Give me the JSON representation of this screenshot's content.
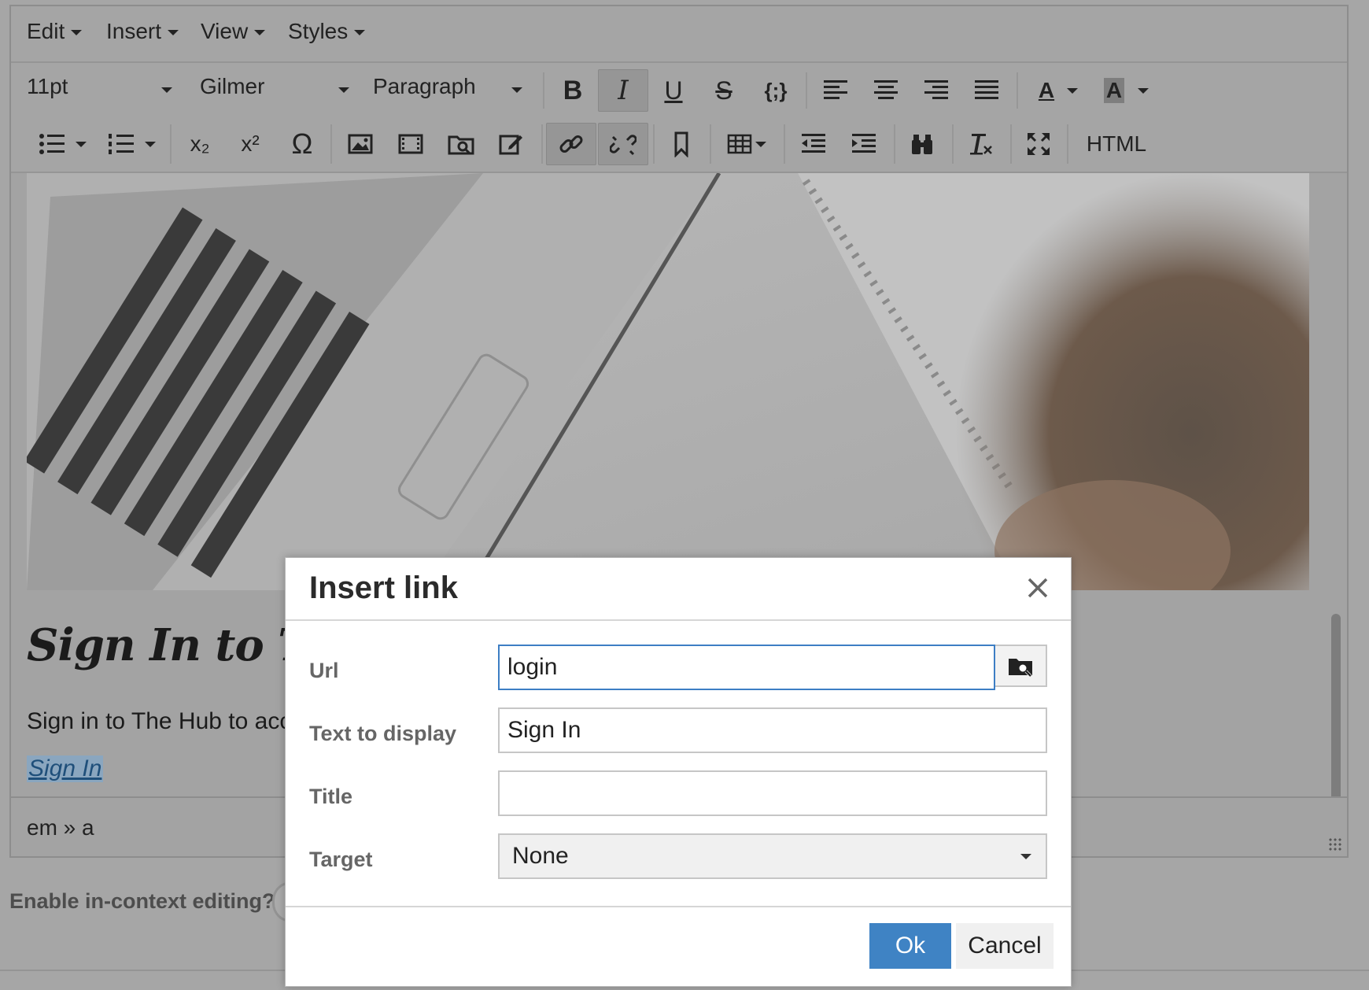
{
  "menubar": {
    "items": [
      {
        "label": "Edit"
      },
      {
        "label": "Insert"
      },
      {
        "label": "View"
      },
      {
        "label": "Styles"
      }
    ]
  },
  "toolbar": {
    "font_size": "11pt",
    "font_family": "Gilmer",
    "block_format": "Paragraph",
    "bold_label": "B",
    "italic_label": "I",
    "underline_label": "U",
    "strike_label": "S",
    "code_label": "{;}",
    "text_color_label": "A",
    "bg_color_label": "A",
    "subscript_label": "x₂",
    "superscript_label": "x²",
    "special_char_label": "Ω",
    "html_label": "HTML"
  },
  "content": {
    "heading": "Sign In to Th",
    "body": "Sign in to The Hub to acc",
    "selected_link": "Sign In"
  },
  "statusbar": {
    "path": "em » a"
  },
  "below_editor": {
    "enable_label": "Enable in-context editing?"
  },
  "dialog": {
    "title": "Insert link",
    "url_label": "Url",
    "url_value": "login",
    "text_label": "Text to display",
    "text_value": "Sign In",
    "title_label": "Title",
    "title_value": "",
    "target_label": "Target",
    "target_value": "None",
    "ok_label": "Ok",
    "cancel_label": "Cancel"
  },
  "colors": {
    "overlay_gray": "#a6a6a6",
    "ok_button": "#3f83c4",
    "focus_border": "#3d7ec4"
  }
}
